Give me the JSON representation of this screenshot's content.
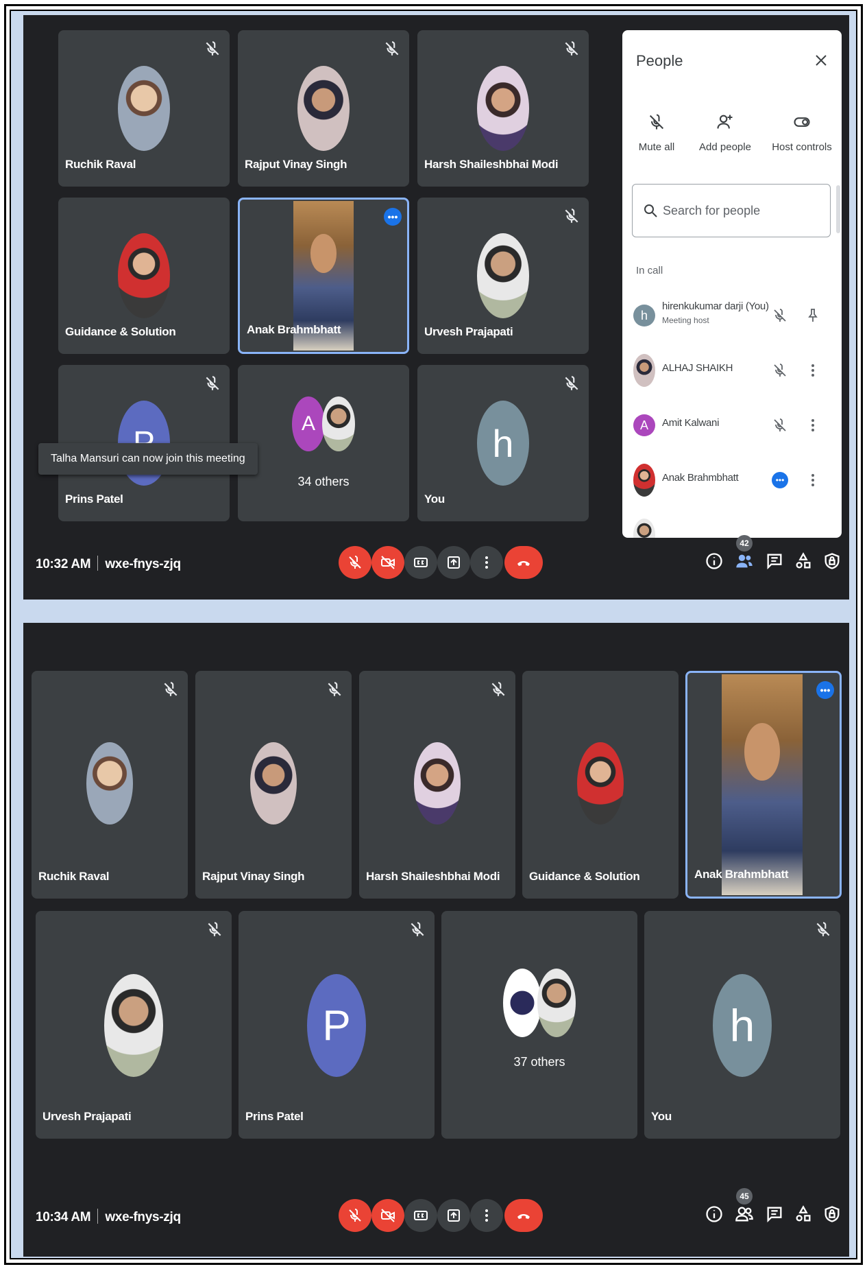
{
  "screen1": {
    "tiles": [
      {
        "name": "Ruchik Raval"
      },
      {
        "name": "Rajput Vinay Singh"
      },
      {
        "name": "Harsh Shaileshbhai Modi"
      },
      {
        "name": "Guidance & Solution"
      },
      {
        "name": "Anak Brahmbhatt"
      },
      {
        "name": "Urvesh Prajapati"
      },
      {
        "name": "Prins Patel",
        "avatar_letter": "P"
      },
      {
        "name": "34 others",
        "avatar_letter": "A"
      },
      {
        "name": "You",
        "avatar_letter": "h"
      }
    ],
    "toast": "Talha Mansuri can now join this meeting",
    "time": "10:32 AM",
    "meeting_code": "wxe-fnys-zjq",
    "participant_count": "42"
  },
  "people_panel": {
    "title": "People",
    "actions": {
      "mute_all": "Mute all",
      "add_people": "Add people",
      "host_controls": "Host controls"
    },
    "search_placeholder": "Search for people",
    "section": "In call",
    "participants": [
      {
        "name": "hirenkukumar darji (You)",
        "sub": "Meeting host",
        "avatar_letter": "h"
      },
      {
        "name": "ALHAJ SHAIKH"
      },
      {
        "name": "Amit Kalwani",
        "avatar_letter": "A"
      },
      {
        "name": "Anak Brahmbhatt"
      }
    ]
  },
  "screen2": {
    "tiles": [
      {
        "name": "Ruchik Raval"
      },
      {
        "name": "Rajput Vinay Singh"
      },
      {
        "name": "Harsh Shaileshbhai Modi"
      },
      {
        "name": "Guidance & Solution"
      },
      {
        "name": "Anak Brahmbhatt"
      },
      {
        "name": "Urvesh Prajapati"
      },
      {
        "name": "Prins Patel",
        "avatar_letter": "P"
      },
      {
        "name": "37 others"
      },
      {
        "name": "You",
        "avatar_letter": "h"
      }
    ],
    "time": "10:34 AM",
    "meeting_code": "wxe-fnys-zjq",
    "participant_count": "45"
  },
  "colors": {
    "accent": "#1a73e8",
    "danger": "#ea4335",
    "tile": "#3c4043",
    "background": "#202124",
    "highlight": "#8ab4f8"
  },
  "icons": {
    "mic_off": "mic-off-icon",
    "camera_off": "camera-off-icon",
    "captions": "captions-icon",
    "present": "present-icon",
    "more": "more-vert-icon",
    "hangup": "hangup-icon",
    "info": "info-icon",
    "people": "people-icon",
    "chat": "chat-icon",
    "activities": "activities-icon",
    "host": "host-lock-icon"
  }
}
